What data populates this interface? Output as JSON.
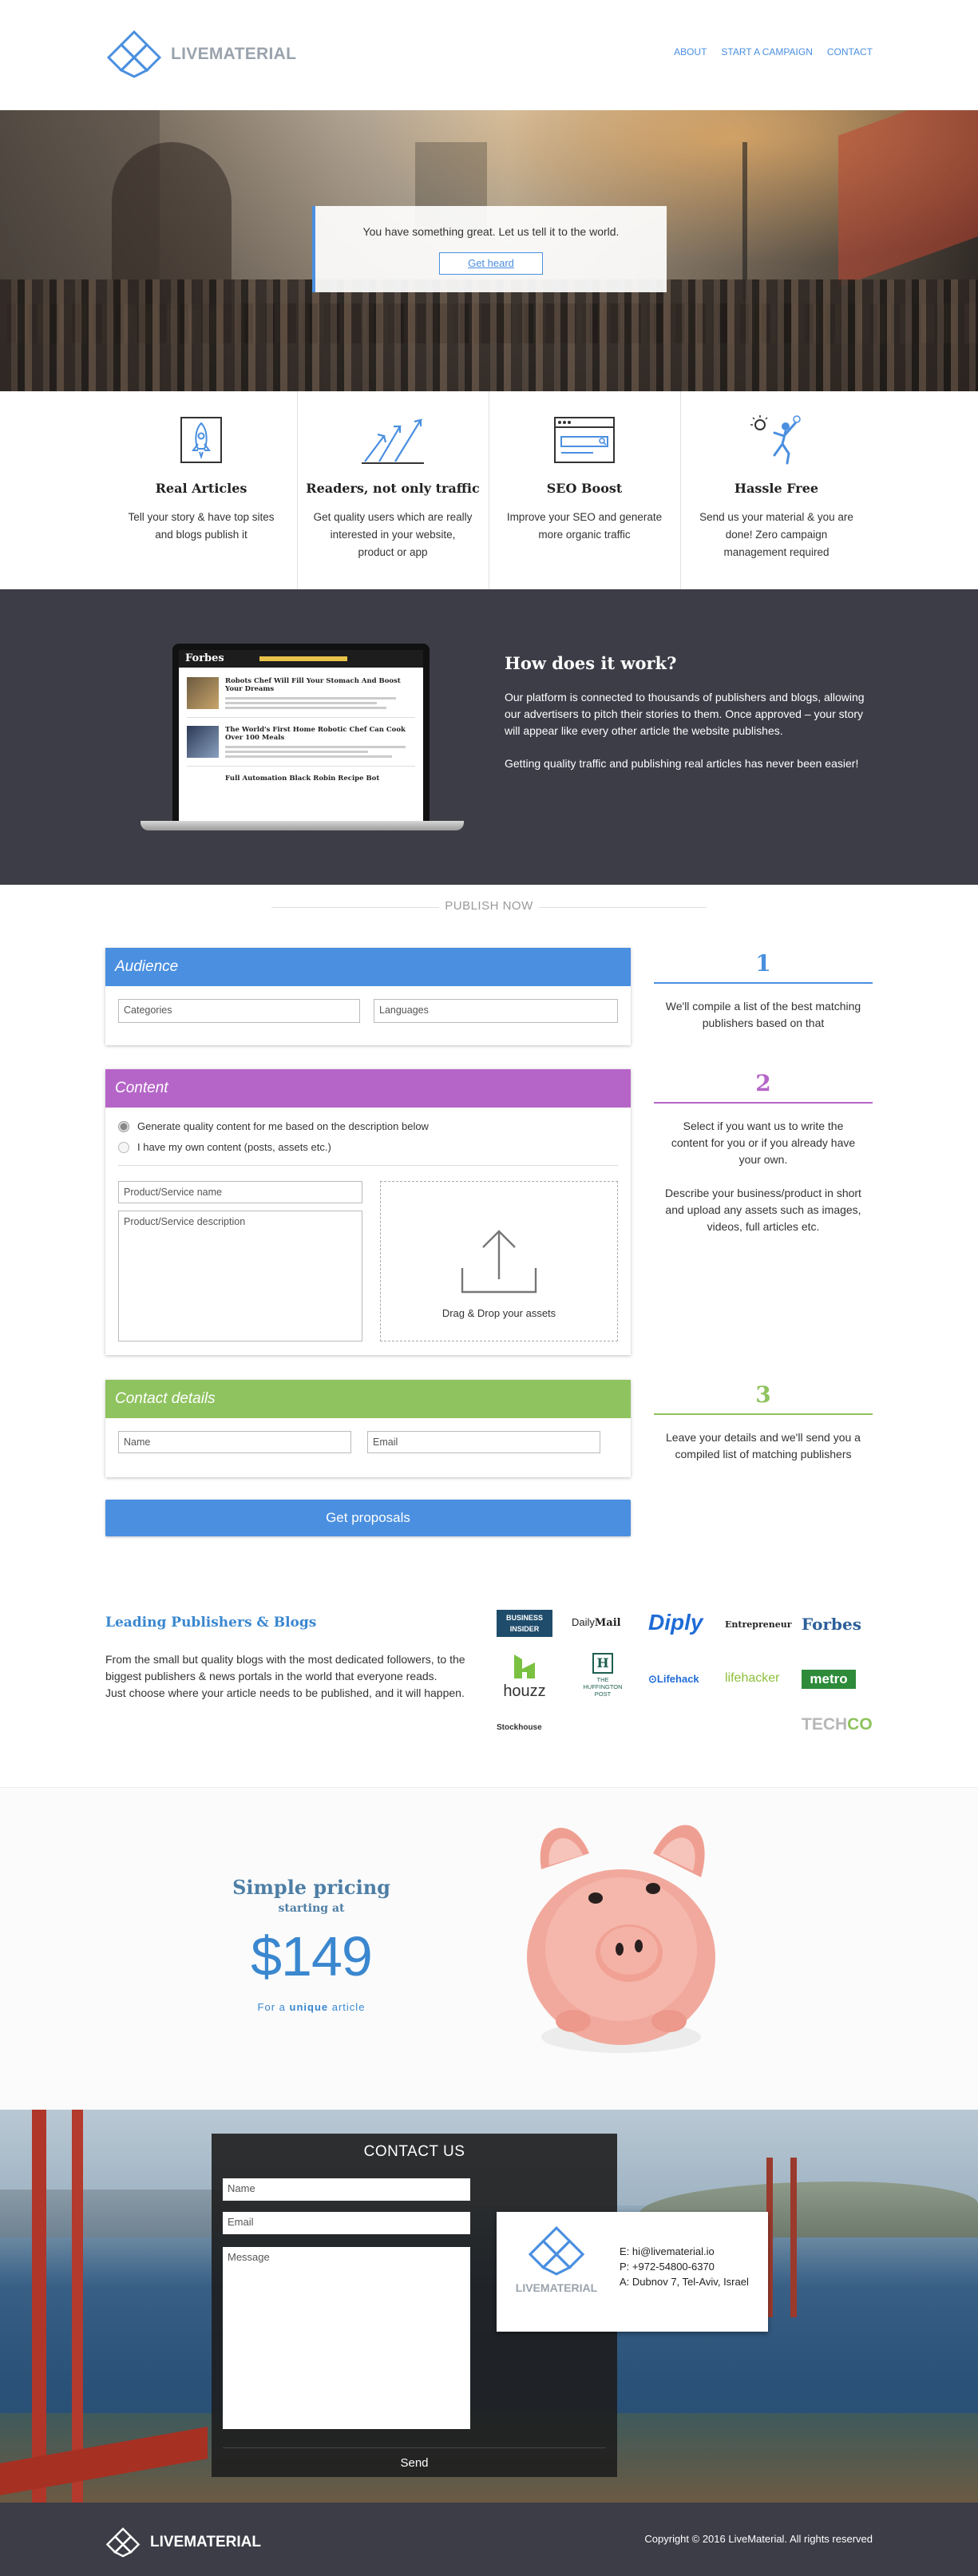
{
  "brand": {
    "prefix": "LIVE",
    "suffix": "MATERIAL"
  },
  "nav": {
    "items": [
      "ABOUT",
      "START A CAMPAIGN",
      "CONTACT"
    ]
  },
  "hero": {
    "tagline": "You have something great. Let us tell it to the world.",
    "button": "Get heard"
  },
  "features": [
    {
      "icon": "rocket-icon",
      "title": "Real Articles",
      "text": "Tell your story & have top sites and blogs publish it"
    },
    {
      "icon": "growth-arrows-icon",
      "title": "Readers, not only traffic",
      "text": "Get quality users which are really interested in your website, product or app"
    },
    {
      "icon": "browser-search-icon",
      "title": "SEO Boost",
      "text": "Improve your SEO and generate more organic traffic"
    },
    {
      "icon": "volleyball-player-icon",
      "title": "Hassle Free",
      "text": "Send us your material & you are done! Zero campaign management required"
    }
  ],
  "how": {
    "title": "How does it work?",
    "p1": "Our platform is connected to thousands of publishers and blogs, allowing our advertisers to pitch their stories to them. Once approved – your story will appear like every other article the website publishes.",
    "p2": "Getting quality traffic and publishing real articles has never been easier!",
    "screen": {
      "brand": "Forbes",
      "a1": "Robots Chef Will Fill Your Stomach And Boost Your Dreams",
      "a2": "The World's First Home Robotic Chef Can Cook Over 100 Meals",
      "a3": "Full Automation Black Robin Recipe Bot"
    }
  },
  "publish": {
    "title": "PUBLISH NOW",
    "audience": {
      "header": "Audience",
      "categories": "Categories",
      "languages": "Languages"
    },
    "content": {
      "header": "Content",
      "radio1": "Generate quality content for me based on the description below",
      "radio2": "I have my own content (posts, assets etc.)",
      "name_ph": "Product/Service name",
      "desc_ph": "Product/Service description",
      "drop": "Drag & Drop your assets"
    },
    "contact": {
      "header": "Contact details",
      "name_ph": "Name",
      "email_ph": "Email"
    },
    "submit": "Get proposals"
  },
  "steps": [
    {
      "num": "1",
      "color": "#4a8fe0",
      "text": "We'll compile a list of the best matching publishers based on that"
    },
    {
      "num": "2",
      "color": "#b565c8",
      "text": "Select if you want us to write the content for you or if you already have your own.",
      "text2": "Describe your business/product in short and upload any assets such as images, videos, full articles etc."
    },
    {
      "num": "3",
      "color": "#8fc35f",
      "text": "Leave your details and we'll send you a compiled list of matching publishers"
    }
  ],
  "publishers": {
    "title": "Leading Publishers & Blogs",
    "text1": "From the small but quality blogs with the most dedicated followers, to the biggest publishers & news portals in the world that everyone reads.",
    "text2": "Just choose where your article needs to be published, and it will happen.",
    "logos": {
      "bi": "BUSINESS INSIDER",
      "dm_a": "Daily",
      "dm_b": "Mail",
      "diply": "Diply",
      "ent": "Entrepreneur",
      "forbes": "Forbes",
      "houzz": "houzz",
      "huff": "THE HUFFINGTON POST",
      "lifehack": "Lifehack",
      "lifehacker": "lifehacker",
      "metro": "metro",
      "stock": "Stockhouse",
      "tech": "TECH",
      "co": "CO"
    }
  },
  "pricing": {
    "title": "Simple pricing",
    "starting": "starting at",
    "amount": "$149",
    "for_a": "For a",
    "unique": "unique",
    "article": "article"
  },
  "contact": {
    "title": "CONTACT US",
    "name_ph": "Name",
    "email_ph": "Email",
    "message_ph": "Message",
    "send": "Send",
    "email": "E: hi@livematerial.io",
    "phone": "P: +972-54800-6370",
    "address": "A: Dubnov 7, Tel-Aviv, Israel"
  },
  "footer": {
    "brand": "LIVEMATERIAL",
    "copyright": "Copyright © 2016 LiveMaterial. All rights reserved"
  },
  "colors": {
    "blue": "#4a8fe0",
    "purple": "#b565c8",
    "green": "#8fc35f",
    "dark": "#3c3d47"
  }
}
